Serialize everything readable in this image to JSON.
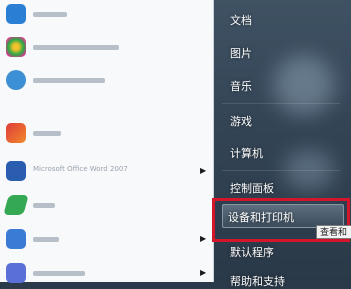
{
  "left_programs": [
    {
      "label": "",
      "color": "#2a7fd4"
    },
    {
      "label": "",
      "color": "#27a844"
    },
    {
      "label": "",
      "color": "#3d8fd6"
    },
    {
      "label": "",
      "color": "#e03b3b"
    },
    {
      "label": "Microsoft Office Word 2007",
      "color": "#2a5db0"
    },
    {
      "label": "",
      "color": "#34a853"
    },
    {
      "label": "",
      "color": "#3a7bd5"
    },
    {
      "label": "",
      "color": "#5a6fd8"
    }
  ],
  "right_places": [
    {
      "label": "文档"
    },
    {
      "label": "图片"
    },
    {
      "label": "音乐"
    },
    {
      "label": "游戏"
    },
    {
      "label": "计算机"
    },
    {
      "label": "控制面板"
    },
    {
      "label": "设备和打印机"
    },
    {
      "label": "默认程序"
    },
    {
      "label": "帮助和支持"
    }
  ],
  "tooltip": "查看和",
  "highlight_color": "#d4162a"
}
